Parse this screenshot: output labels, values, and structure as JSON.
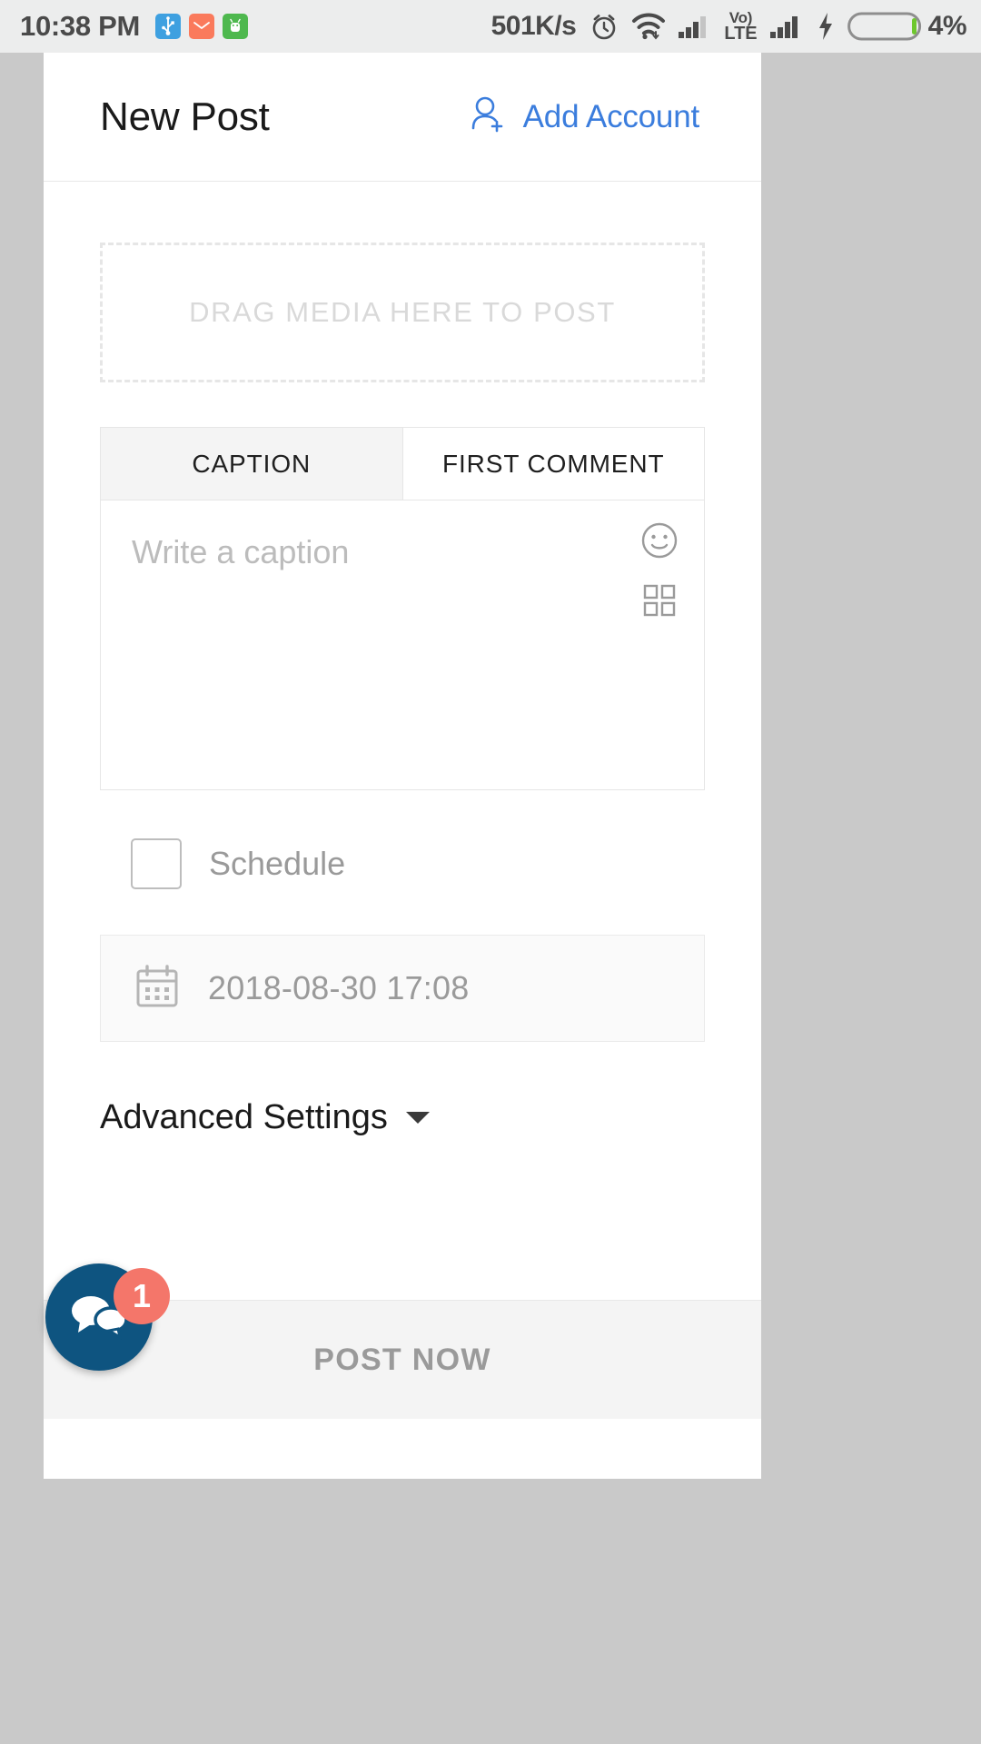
{
  "status_bar": {
    "clock": "10:38 PM",
    "network_speed": "501K/s",
    "volte_line1": "Vo)",
    "volte_line2": "LTE",
    "battery_percent": "4%",
    "left_icons": [
      "usb-icon",
      "mail-icon",
      "android-icon"
    ],
    "right_icons": [
      "alarm-icon",
      "wifi-icon",
      "signal-icon",
      "volte-icon",
      "signal2-icon",
      "charging-bolt-icon",
      "battery-icon"
    ],
    "colors": {
      "background": "#eceded",
      "text": "#4a4a4a",
      "usb_tile": "#3ea0e0",
      "mail_tile": "#fa7a5c",
      "android_tile": "#4eb84e",
      "battery_fill": "#6ec72e"
    }
  },
  "appbar": {
    "title": "New Post",
    "add_account_label": "Add Account",
    "add_account_icon": "person-add-icon",
    "accent_color": "#3b7ddd"
  },
  "dropzone": {
    "label": "DRAG MEDIA HERE TO POST"
  },
  "tabs": [
    {
      "label": "CAPTION",
      "active": true
    },
    {
      "label": "FIRST COMMENT",
      "active": false
    }
  ],
  "caption": {
    "placeholder": "Write a caption",
    "value": "",
    "emoji_icon": "emoji-smiley-icon",
    "grid_icon": "grid-squares-icon"
  },
  "schedule": {
    "label": "Schedule",
    "checked": false
  },
  "date_field": {
    "icon": "calendar-icon",
    "value": "2018-08-30 17:08"
  },
  "advanced": {
    "label": "Advanced Settings",
    "caret_icon": "chevron-down-icon"
  },
  "bottom_bar": {
    "post_label": "POST NOW"
  },
  "chat_fab": {
    "icon": "chat-bubbles-icon",
    "badge_count": "1",
    "fab_color": "#0e5480",
    "badge_color": "#f4766a"
  }
}
